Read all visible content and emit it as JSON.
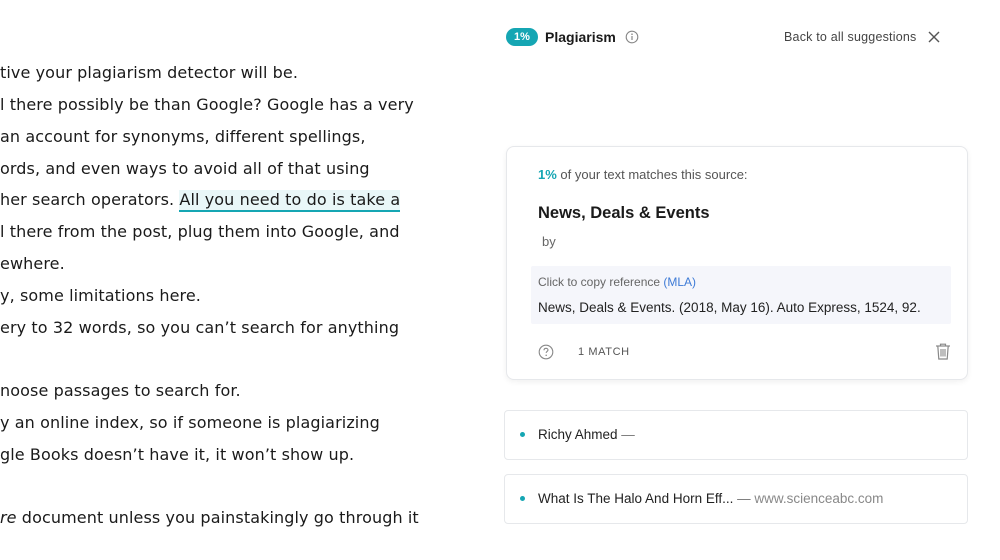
{
  "document": {
    "lines": [
      "tive your plagiarism detector will be.",
      "l there possibly be than Google? Google has a very",
      "an account for synonyms, different spellings,",
      "ords, and even ways to avoid all of that using",
      "her search operators. ",
      "l there from the post, plug them into Google, and",
      "ewhere.",
      "y, some limitations here.",
      "ery to 32 words, so you can’t search for anything",
      "noose passages to search for.",
      "y an online index, so if someone is plagiarizing",
      "gle Books doesn’t have it, it won’t show up.",
      "re",
      " document unless you painstakingly go through it"
    ],
    "highlight": "All you need to do is take a"
  },
  "panel": {
    "badge": "1%",
    "title": "Plagiarism",
    "back_label": "Back to all suggestions",
    "card": {
      "match_pct": "1%",
      "match_text": " of your text matches this source:",
      "source_title": "News, Deals & Events",
      "by_label": "by",
      "ref_hint": "Click to copy reference ",
      "ref_format": "(MLA)",
      "ref_text": "News, Deals & Events. (2018, May 16). Auto Express, 1524, 92.",
      "match_count": "1 MATCH"
    },
    "sources": [
      {
        "name": "Richy Ahmed",
        "sep": " —",
        "domain": ""
      },
      {
        "name": "What Is The Halo And Horn Eff...",
        "sep": " — ",
        "domain": "www.scienceabc.com"
      }
    ]
  },
  "colors": {
    "accent": "#15a6b3",
    "link": "#3e7bd6"
  }
}
